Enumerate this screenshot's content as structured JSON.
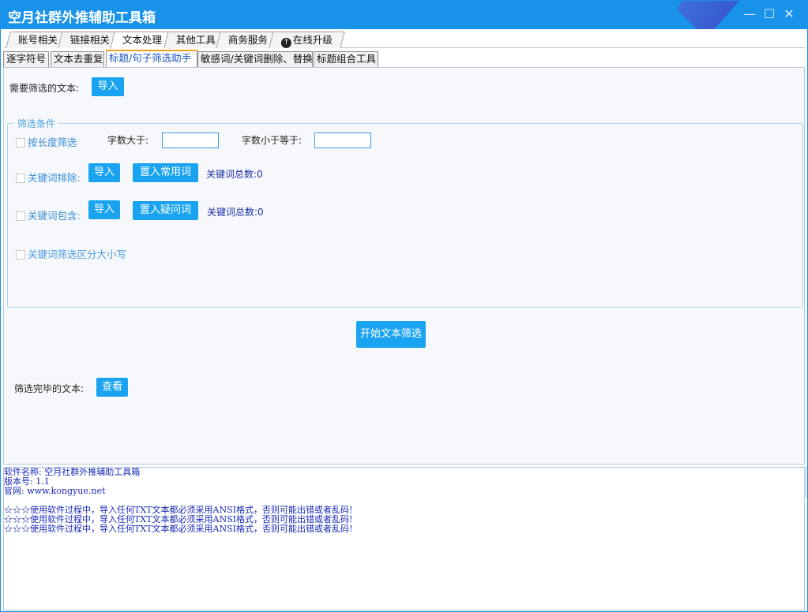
{
  "window": {
    "title": "空月社群外推辅助工具箱",
    "controls": {
      "minimize": "—",
      "maximize": "☐",
      "close": "✕"
    }
  },
  "main_tabs": [
    {
      "label": "账号相关"
    },
    {
      "label": "链接相关"
    },
    {
      "label": "文本处理",
      "active": true
    },
    {
      "label": "其他工具"
    },
    {
      "label": "商务服务"
    },
    {
      "label": "在线升级",
      "icon": "upload-icon"
    }
  ],
  "sub_tabs": [
    {
      "label": "逐字符号"
    },
    {
      "label": "文本去重复"
    },
    {
      "label": "标题/句子筛选助手",
      "active": true
    },
    {
      "label": "敏感词/关键词删除、替换"
    },
    {
      "label": "标题组合工具"
    }
  ],
  "panel": {
    "import_label": "需要筛选的文本:",
    "import_button": "导入",
    "group_title": "筛选条件",
    "length_filter": {
      "checkbox_label": "按长度筛选",
      "greater_label": "字数大于:",
      "greater_value": "",
      "lessequal_label": "字数小于等于:",
      "lessequal_value": ""
    },
    "keyword_exclude": {
      "checkbox_label": "关键词排除:",
      "import_button": "导入",
      "preset_button": "置入常用词",
      "count_label": "关键词总数:",
      "count": "0"
    },
    "keyword_include": {
      "checkbox_label": "关键词包含:",
      "import_button": "导入",
      "preset_button": "置入疑问词",
      "count_label": "关键词总数:",
      "count": "0"
    },
    "case_sensitive_label": "关键词筛选区分大小写",
    "start_button": "开始文本筛选",
    "result_label": "筛选完毕的文本:",
    "view_button": "查看"
  },
  "log": {
    "lines": [
      "软件名称: 空月社群外推辅助工具箱",
      "版本号: 1.1",
      "官网: www.kongyue.net",
      "",
      "☆☆☆使用软件过程中，导入任何TXT文本都必须采用ANSI格式，否则可能出错或者乱码!",
      "☆☆☆使用软件过程中，导入任何TXT文本都必须采用ANSI格式，否则可能出错或者乱码!",
      "☆☆☆使用软件过程中，导入任何TXT文本都必须采用ANSI格式，否则可能出错或者乱码!"
    ]
  },
  "colors": {
    "titlebar": "#1993ea",
    "button": "#1aa3f0",
    "active_tab_accent": "#f4a21b",
    "log_text": "#1628b8"
  }
}
